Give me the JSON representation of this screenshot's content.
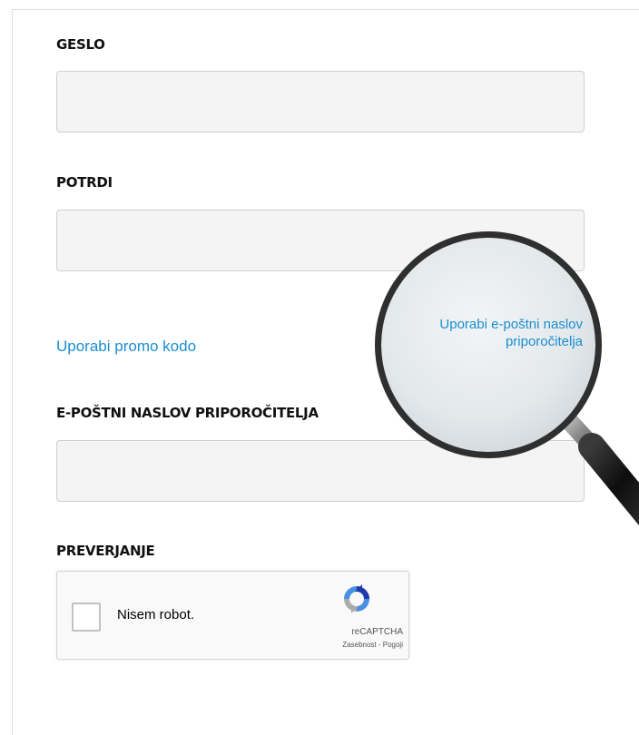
{
  "form": {
    "password_label": "GESLO",
    "confirm_label": "POTRDI",
    "promo_link": "Uporabi promo kodo",
    "referrer_label": "E-POŠTNI NASLOV PRIPOROČITELJA",
    "verification_label": "PREVERJANJE"
  },
  "captcha": {
    "checkbox_label": "Nisem robot.",
    "brand": "reCAPTCHA",
    "privacy": "Zasebnost",
    "separator": " - ",
    "terms": "Pogoji"
  },
  "magnifier": {
    "line1": "Uporabi e-poštni naslov",
    "line2": "priporočitelja",
    "link_color": "#1a8dcf"
  },
  "icons": {
    "captcha_logo": "recaptcha-icon",
    "magnifier": "magnifying-glass-icon"
  }
}
